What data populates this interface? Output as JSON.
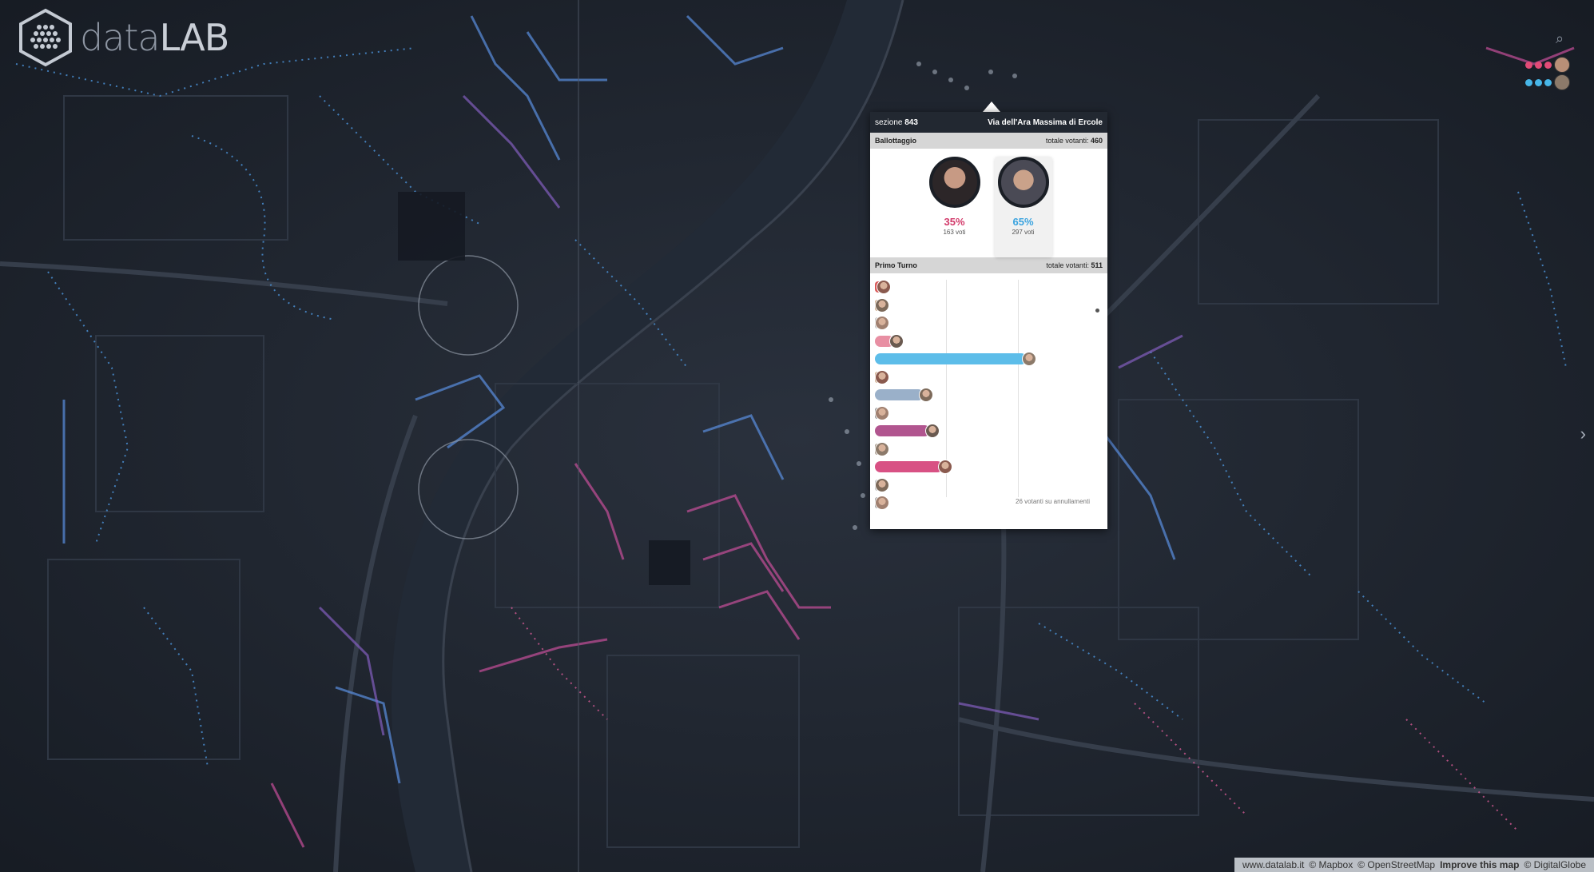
{
  "brand": {
    "name_a": "data",
    "name_b": "LAB"
  },
  "popup": {
    "section_label": "sezione",
    "section_number": "843",
    "address": "Via dell'Ara Massima di Ercole",
    "ballot": {
      "label": "Ballottaggio",
      "total_label": "totale votanti",
      "total": "460",
      "candidates": [
        {
          "pct": "35%",
          "votes": "163 voti",
          "color": "#d23a6a",
          "photo_color": "#8a5a4e"
        },
        {
          "pct": "65%",
          "votes": "297 voti",
          "color": "#3aa3df",
          "photo_color": "#7d6a5a"
        }
      ]
    },
    "first_round": {
      "label": "Primo Turno",
      "total_label": "totale votanti",
      "total": "511",
      "note": "26 votanti su annullamenti",
      "bars": [
        {
          "value": 0.02,
          "color": "#d95a5a"
        },
        {
          "value": 0.01,
          "color": "#c9a27e"
        },
        {
          "value": 0.01,
          "color": "#bbbbbb"
        },
        {
          "value": 0.06,
          "color": "#e88fa3"
        },
        {
          "value": 0.47,
          "color": "#5dbde9"
        },
        {
          "value": 0.01,
          "color": "#c9a27e"
        },
        {
          "value": 0.15,
          "color": "#9ab0c9"
        },
        {
          "value": 0.01,
          "color": "#888888"
        },
        {
          "value": 0.17,
          "color": "#b1558f"
        },
        {
          "value": 0.01,
          "color": "#9f8f7f"
        },
        {
          "value": 0.21,
          "color": "#d85184"
        },
        {
          "value": 0.01,
          "color": "#bbbbbb"
        },
        {
          "value": 0.01,
          "color": "#999999"
        }
      ]
    }
  },
  "legend": {
    "rows": [
      {
        "dots": [
          "#e24b77",
          "#e24b77",
          "#e24b77"
        ]
      },
      {
        "dots": [
          "#47b6e8",
          "#47b6e8",
          "#47b6e8"
        ]
      }
    ]
  },
  "attribution": {
    "site": "www.datalab.it",
    "mapbox": "© Mapbox",
    "osm": "© OpenStreetMap",
    "improve": "Improve this map",
    "dg": "© DigitalGlobe"
  },
  "icons": {
    "search": "search-icon",
    "next": "chevron-right-icon",
    "logo": "hexagon-logo-icon"
  }
}
